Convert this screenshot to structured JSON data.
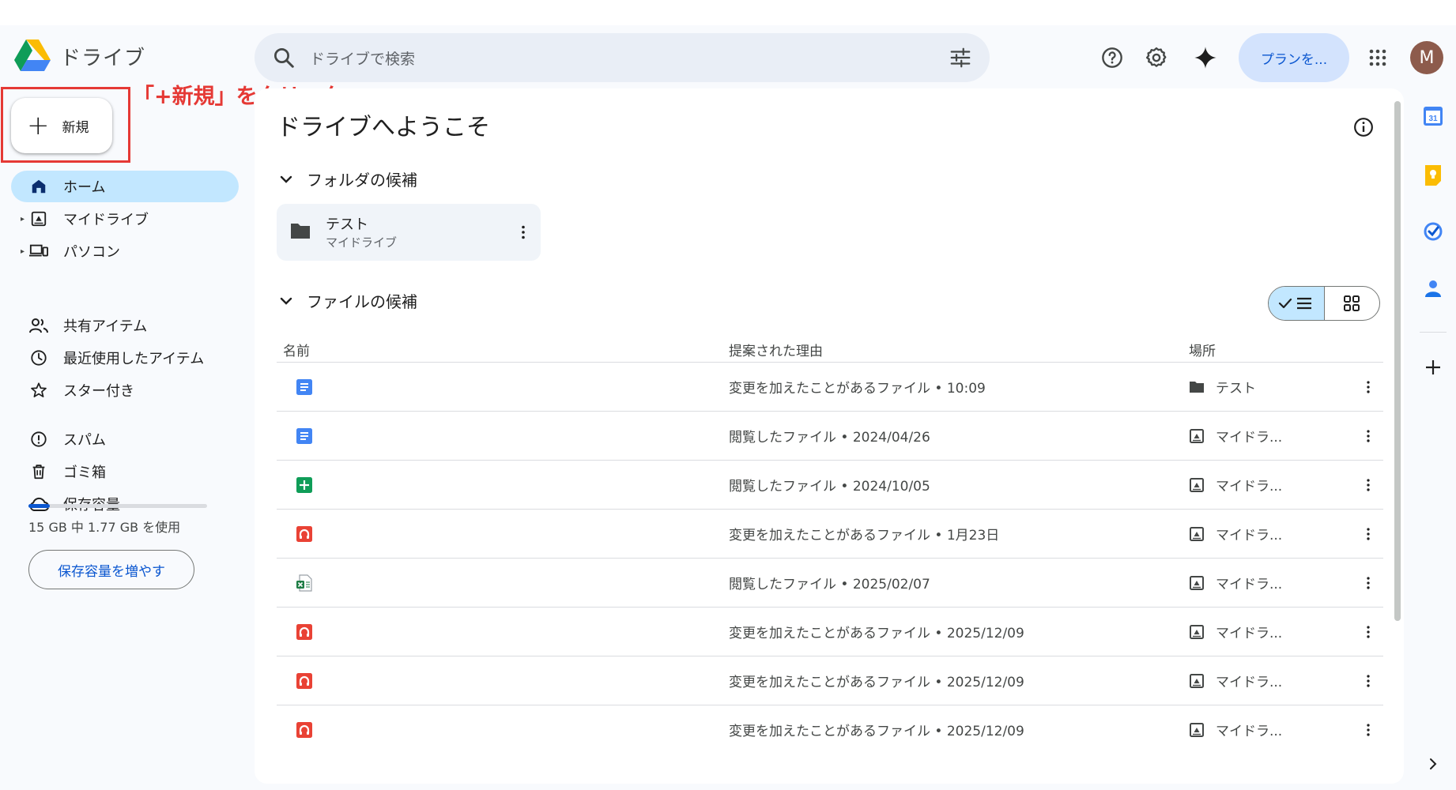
{
  "header": {
    "app_name": "ドライブ",
    "search_placeholder": "ドライブで検索",
    "plan_button": "プランを...",
    "avatar_initial": "M",
    "icons": [
      "drive-logo-icon",
      "search-icon",
      "tune-icon",
      "help-icon",
      "settings-icon",
      "gemini-sparkle-icon",
      "apps-grid-icon"
    ]
  },
  "new_button": {
    "label": "新規"
  },
  "annotation": {
    "text": "「+新規」をクリック",
    "color": "#e53935"
  },
  "sidebar": {
    "items": [
      {
        "label": "ホーム",
        "icon": "home-icon",
        "active": true
      },
      {
        "label": "マイドライブ",
        "icon": "my-drive-icon",
        "expandable": true
      },
      {
        "label": "パソコン",
        "icon": "computers-icon",
        "expandable": true
      },
      {
        "label": "共有アイテム",
        "icon": "shared-icon"
      },
      {
        "label": "最近使用したアイテム",
        "icon": "recent-icon"
      },
      {
        "label": "スター付き",
        "icon": "star-icon"
      },
      {
        "label": "スパム",
        "icon": "spam-icon"
      },
      {
        "label": "ゴミ箱",
        "icon": "trash-icon"
      },
      {
        "label": "保存容量",
        "icon": "cloud-icon"
      }
    ],
    "storage": {
      "text": "15 GB 中 1.77 GB を使用",
      "used_fraction": 0.118,
      "button": "保存容量を増やす"
    }
  },
  "main": {
    "title": "ドライブへようこそ",
    "folders_section": "フォルダの候補",
    "folder": {
      "name": "テスト",
      "location": "マイドライブ"
    },
    "files_section": "ファイルの候補",
    "columns": {
      "name": "名前",
      "reason": "提案された理由",
      "location": "場所"
    },
    "files": [
      {
        "type": "docs",
        "reason": "変更を加えたことがあるファイル • 10:09",
        "location": "テスト",
        "loc_icon": "folder-icon"
      },
      {
        "type": "docs",
        "reason": "閲覧したファイル • 2024/04/26",
        "location": "マイドラ...",
        "loc_icon": "my-drive-icon"
      },
      {
        "type": "sheets",
        "reason": "閲覧したファイル • 2024/10/05",
        "location": "マイドラ...",
        "loc_icon": "my-drive-icon"
      },
      {
        "type": "audio",
        "reason": "変更を加えたことがあるファイル • 1月23日",
        "location": "マイドラ...",
        "loc_icon": "my-drive-icon"
      },
      {
        "type": "excel",
        "reason": "閲覧したファイル • 2025/02/07",
        "location": "マイドラ...",
        "loc_icon": "my-drive-icon"
      },
      {
        "type": "audio",
        "reason": "変更を加えたことがあるファイル • 2025/12/09",
        "location": "マイドラ...",
        "loc_icon": "my-drive-icon"
      },
      {
        "type": "audio",
        "reason": "変更を加えたことがあるファイル • 2025/12/09",
        "location": "マイドラ...",
        "loc_icon": "my-drive-icon"
      },
      {
        "type": "audio",
        "reason": "変更を加えたことがあるファイル • 2025/12/09",
        "location": "マイドラ...",
        "loc_icon": "my-drive-icon"
      }
    ]
  },
  "side_panel": {
    "calendar_day": "31",
    "icons": [
      "calendar-icon",
      "keep-icon",
      "tasks-icon",
      "contacts-icon",
      "add-icon",
      "chevron-right-icon"
    ]
  },
  "colors": {
    "accent": "#0b57d0",
    "active_nav": "#c2e7ff",
    "docs": "#4285f4",
    "sheets": "#0f9d58",
    "audio": "#e94235"
  }
}
